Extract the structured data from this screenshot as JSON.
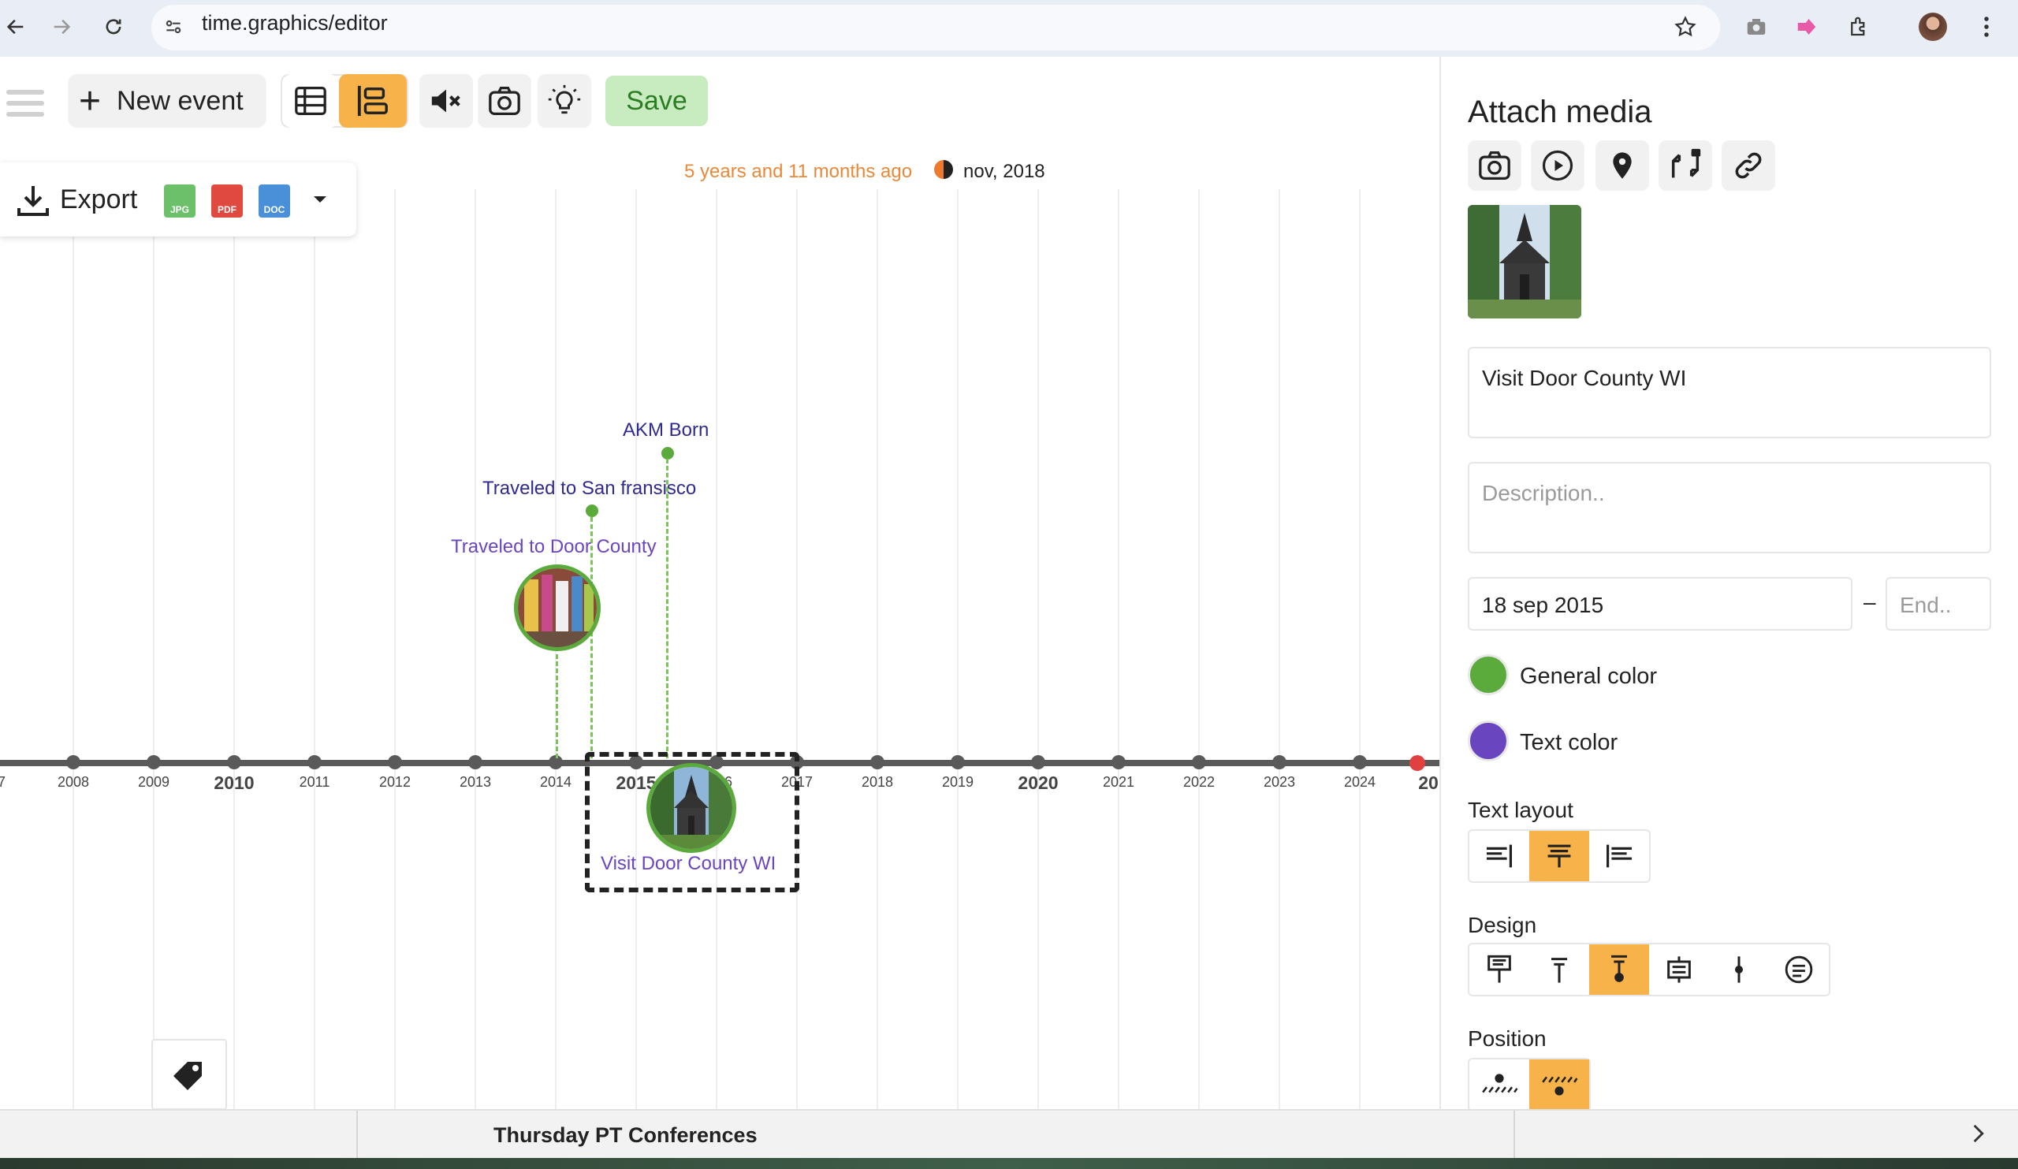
{
  "browser": {
    "url": "time.graphics/editor"
  },
  "toolbar": {
    "new_event_label": "New event",
    "save_label": "Save"
  },
  "export": {
    "label": "Export",
    "formats": [
      "JPG",
      "PDF",
      "DOC"
    ]
  },
  "status": {
    "ago": "5 years and 11 months ago",
    "date": "nov, 2018"
  },
  "timeline": {
    "years": [
      "7",
      "2008",
      "2009",
      "2010",
      "2011",
      "2012",
      "2013",
      "2014",
      "2015",
      "2016",
      "2017",
      "2018",
      "2019",
      "2020",
      "2021",
      "2022",
      "2023",
      "2024",
      "20"
    ],
    "major_years": [
      "2010",
      "2015",
      "2020",
      "20"
    ],
    "events": [
      {
        "label": "AKM Born"
      },
      {
        "label": "Traveled to San fransisco"
      },
      {
        "label": "Traveled to Door County"
      },
      {
        "label": "Visit Door County WI"
      }
    ]
  },
  "panel": {
    "title": "Attach media",
    "event_title": "Visit Door County WI",
    "description_placeholder": "Description..",
    "start_date": "18 sep 2015",
    "end_placeholder": "End..",
    "date_separator": "–",
    "general_color_label": "General color",
    "general_color": "#5aaa3c",
    "text_color_label": "Text color",
    "text_color": "#6a45c0",
    "text_layout_label": "Text layout",
    "design_label": "Design",
    "position_label": "Position"
  },
  "bottom": {
    "title": "Thursday PT Conferences"
  },
  "colors": {
    "accent": "#f7b34a",
    "save_bg": "#c8ecc0",
    "ago_text": "#e8893a",
    "event_text": "#2f2a8f"
  }
}
